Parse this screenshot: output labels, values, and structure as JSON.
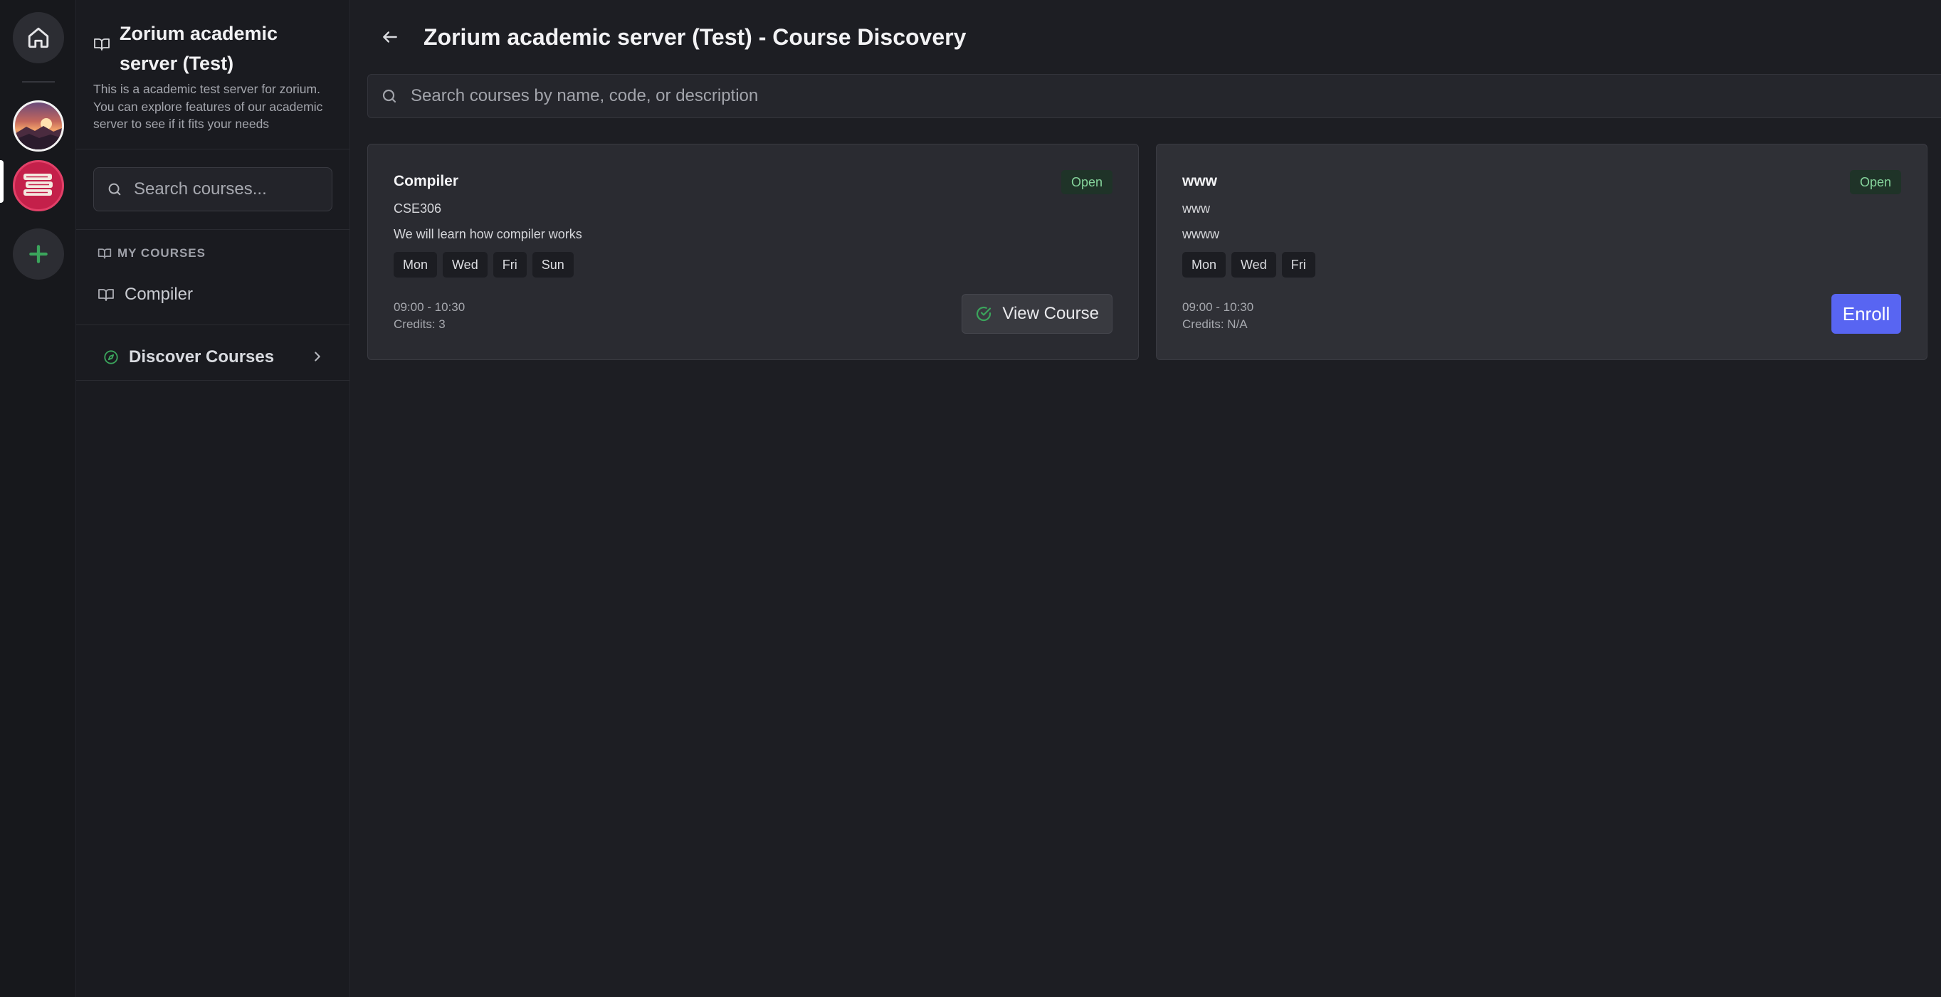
{
  "rail": {
    "home_icon": "home-icon",
    "servers": [
      {
        "name": "server-sunset-avatar"
      },
      {
        "name": "server-books-avatar"
      }
    ],
    "add_icon": "plus-icon"
  },
  "sidebar": {
    "server_title": "Zorium academic server (Test)",
    "server_description": "This is a academic test server for zorium. You can explore features of our academic server to see if it fits your needs",
    "search_placeholder": "Search courses...",
    "my_courses_label": "MY COURSES",
    "my_courses": [
      {
        "label": "Compiler"
      }
    ],
    "discover_label": "Discover Courses"
  },
  "main": {
    "title": "Zorium academic server (Test) - Course Discovery",
    "search_placeholder": "Search courses by name, code, or description",
    "courses": [
      {
        "title": "Compiler",
        "code": "CSE306",
        "description": "We will learn how compiler works",
        "days": [
          "Mon",
          "Wed",
          "Fri",
          "Sun"
        ],
        "time": "09:00 - 10:30",
        "credits": "Credits: 3",
        "status": "Open",
        "action": "View Course"
      },
      {
        "title": "www",
        "code": "www",
        "description": "wwww",
        "days": [
          "Mon",
          "Wed",
          "Fri"
        ],
        "time": "09:00 - 10:30",
        "credits": "Credits: N/A",
        "status": "Open",
        "action": "Enroll"
      }
    ]
  },
  "colors": {
    "accent": "#5865f2",
    "open_badge_text": "#86d49c",
    "add_green": "#3ba55c"
  }
}
